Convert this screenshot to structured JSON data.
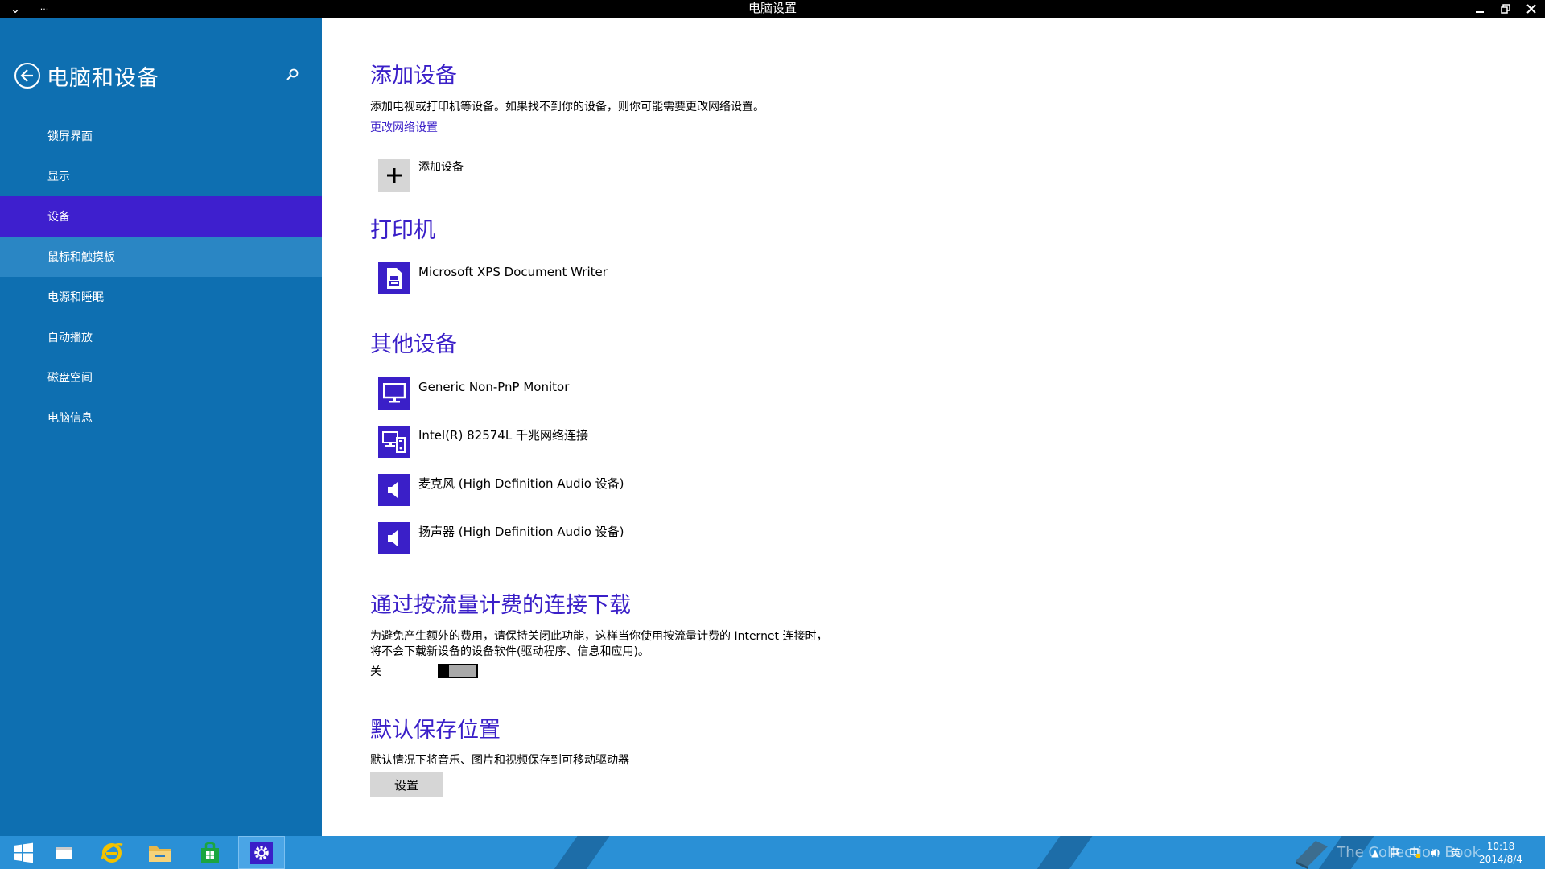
{
  "titlebar": {
    "title": "电脑设置",
    "menu_glyph": "⌄",
    "more_glyph": "···"
  },
  "sidebar": {
    "title": "电脑和设备",
    "items": [
      {
        "label": "锁屏界面"
      },
      {
        "label": "显示"
      },
      {
        "label": "设备",
        "state": "selected"
      },
      {
        "label": "鼠标和触摸板",
        "state": "hover"
      },
      {
        "label": "电源和睡眠"
      },
      {
        "label": "自动播放"
      },
      {
        "label": "磁盘空间"
      },
      {
        "label": "电脑信息"
      }
    ]
  },
  "main": {
    "add_devices": {
      "heading": "添加设备",
      "description": "添加电视或打印机等设备。如果找不到你的设备，则你可能需要更改网络设置。",
      "link": "更改网络设置",
      "add_button_label": "添加设备"
    },
    "printers": {
      "heading": "打印机",
      "items": [
        {
          "label": "Microsoft XPS Document Writer",
          "icon": "printer-icon"
        }
      ]
    },
    "other_devices": {
      "heading": "其他设备",
      "items": [
        {
          "label": "Generic Non-PnP Monitor",
          "icon": "monitor-icon"
        },
        {
          "label": "Intel(R) 82574L 千兆网络连接",
          "icon": "network-icon"
        },
        {
          "label": "麦克风 (High Definition Audio 设备)",
          "icon": "speaker-icon"
        },
        {
          "label": "扬声器 (High Definition Audio 设备)",
          "icon": "speaker-icon"
        }
      ]
    },
    "metered": {
      "heading": "通过按流量计费的连接下载",
      "description_line1": "为避免产生额外的费用，请保持关闭此功能，这样当你使用按流量计费的 Internet 连接时，",
      "description_line2": "将不会下载新设备的设备软件(驱动程序、信息和应用)。",
      "toggle_label": "关",
      "toggle_on": false
    },
    "default_save": {
      "heading": "默认保存位置",
      "description": "默认情况下将音乐、图片和视频保存到可移动驱动器",
      "button_label": "设置"
    }
  },
  "taskbar": {
    "clock_time": "10:18",
    "clock_date": "2014/8/4",
    "ime": "英",
    "watermark": "The Collection Book"
  },
  "colors": {
    "accent": "#3a1fc8",
    "sidebar": "#0e6fb1",
    "taskbar": "#2a90d6"
  }
}
